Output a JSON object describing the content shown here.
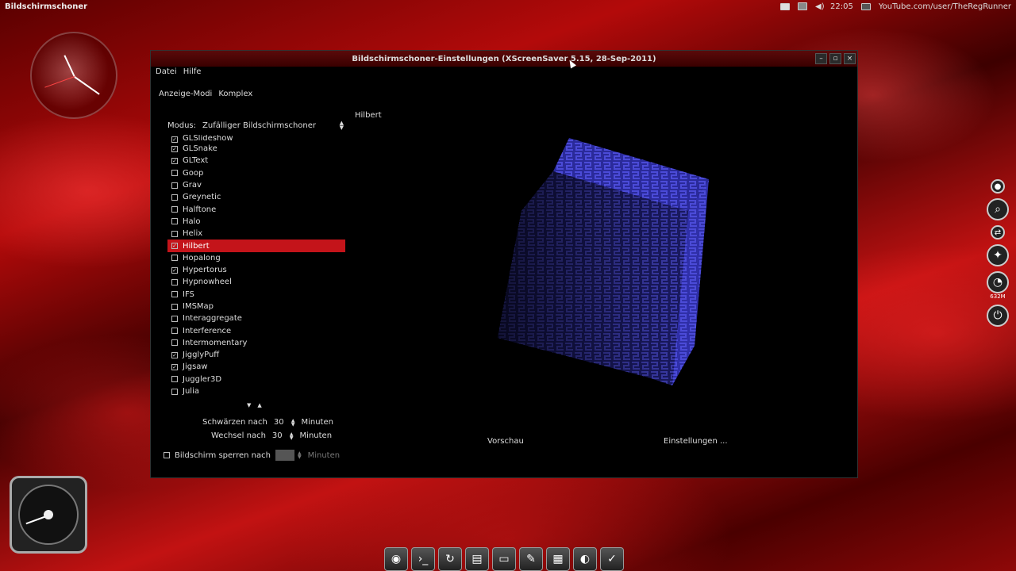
{
  "top_panel": {
    "app_title": "Bildschirmschoner",
    "time": "22:05",
    "url_text": "YouTube.com/user/TheRegRunner"
  },
  "window": {
    "title": "Bildschirmschoner-Einstellungen  (XScreenSaver 5.15, 28-Sep-2011)",
    "controls": {
      "minimize": "–",
      "maximize": "▫",
      "close": "×"
    }
  },
  "menubar": {
    "file": "Datei",
    "help": "Hilfe"
  },
  "tabs": {
    "display_modes": "Anzeige-Modi",
    "advanced": "Komplex"
  },
  "mode": {
    "label": "Modus:",
    "value": "Zufälliger Bildschirmschoner"
  },
  "list": {
    "items": [
      {
        "label": "GLSlideshow",
        "checked": true,
        "partial": true
      },
      {
        "label": "GLSnake",
        "checked": true
      },
      {
        "label": "GLText",
        "checked": true
      },
      {
        "label": "Goop",
        "checked": false
      },
      {
        "label": "Grav",
        "checked": false
      },
      {
        "label": "Greynetic",
        "checked": false
      },
      {
        "label": "Halftone",
        "checked": false
      },
      {
        "label": "Halo",
        "checked": false
      },
      {
        "label": "Helix",
        "checked": false
      },
      {
        "label": "Hilbert",
        "checked": true,
        "selected": true
      },
      {
        "label": "Hopalong",
        "checked": false
      },
      {
        "label": "Hypertorus",
        "checked": true
      },
      {
        "label": "Hypnowheel",
        "checked": false
      },
      {
        "label": "IFS",
        "checked": false
      },
      {
        "label": "IMSMap",
        "checked": false
      },
      {
        "label": "Interaggregate",
        "checked": false
      },
      {
        "label": "Interference",
        "checked": false
      },
      {
        "label": "Intermomentary",
        "checked": false
      },
      {
        "label": "JigglyPuff",
        "checked": true
      },
      {
        "label": "Jigsaw",
        "checked": true
      },
      {
        "label": "Juggler3D",
        "checked": false
      },
      {
        "label": "Julia",
        "checked": false
      }
    ]
  },
  "settings": {
    "blank_after_label": "Schwärzen nach",
    "blank_after_value": "30",
    "cycle_after_label": "Wechsel nach",
    "cycle_after_value": "30",
    "minutes": "Minuten",
    "lock_label": "Bildschirm sperren nach",
    "lock_minutes": "Minuten"
  },
  "preview": {
    "title": "Hilbert",
    "preview_button": "Vorschau",
    "settings_button": "Einstellungen ..."
  },
  "side": {
    "memory": "632M"
  },
  "colors": {
    "selection": "#c4141a",
    "cube": "#2a2a9a"
  }
}
